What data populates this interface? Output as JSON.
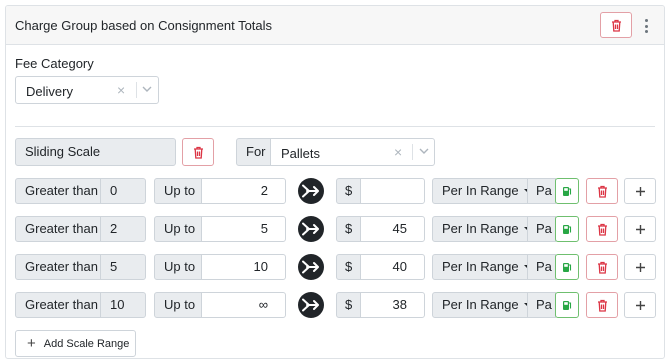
{
  "header": {
    "title": "Charge Group based on Consignment Totals"
  },
  "fee_category": {
    "label": "Fee Category",
    "value": "Delivery",
    "clear": "×"
  },
  "scale": {
    "type": "Sliding Scale",
    "for_label": "For",
    "for_value": "Pallets",
    "clear": "×"
  },
  "rows": [
    {
      "cond": "Greater than",
      "from": "0",
      "upto_label": "Up to",
      "to": "2",
      "currency": "$",
      "amount": "",
      "mode": "Per In Range",
      "unit": "Pa"
    },
    {
      "cond": "Greater than",
      "from": "2",
      "upto_label": "Up to",
      "to": "5",
      "currency": "$",
      "amount": "45",
      "mode": "Per In Range",
      "unit": "Pa"
    },
    {
      "cond": "Greater than",
      "from": "5",
      "upto_label": "Up to",
      "to": "10",
      "currency": "$",
      "amount": "40",
      "mode": "Per In Range",
      "unit": "Pa"
    },
    {
      "cond": "Greater than",
      "from": "10",
      "upto_label": "Up to",
      "to": "∞",
      "currency": "$",
      "amount": "38",
      "mode": "Per In Range",
      "unit": "Pa"
    }
  ],
  "add_range": {
    "label": "Add Scale Range",
    "plus": "+"
  },
  "icons": {
    "trash": "trash-icon",
    "kebab": "kebab-menu-icon",
    "chevron": "chevron-down-icon",
    "arrow": "arrow-right-merge-icon",
    "fuel": "fuel-pump-icon",
    "plus": "plus-icon"
  },
  "colors": {
    "danger": "#dc3545",
    "success": "#28a745",
    "dark": "#212529"
  }
}
